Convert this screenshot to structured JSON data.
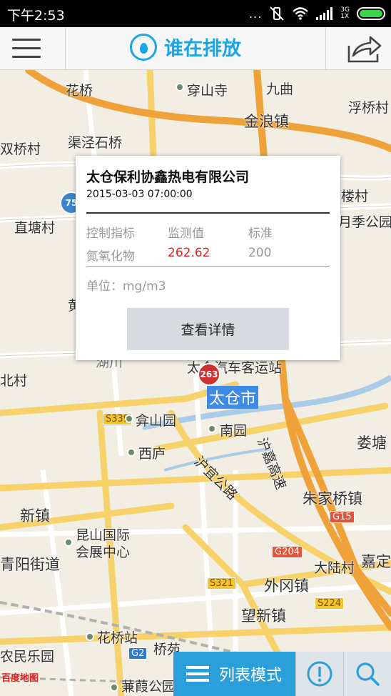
{
  "status_bar": {
    "time": "下午2:53",
    "dots": "...",
    "net_top": "3G",
    "net_bottom": "1X"
  },
  "header": {
    "title": "谁在排放"
  },
  "map": {
    "places": [
      {
        "name": "花桥"
      },
      {
        "name": "穿山寺"
      },
      {
        "name": "九曲"
      },
      {
        "name": "浮桥村"
      },
      {
        "name": "金浪镇"
      },
      {
        "name": "渠泾石桥"
      },
      {
        "name": "双桥村"
      },
      {
        "name": "楼村"
      },
      {
        "name": "月季公园"
      },
      {
        "name": "直塘村"
      },
      {
        "name": "黄"
      },
      {
        "name": "北村"
      },
      {
        "name": "湖川"
      },
      {
        "name": "太仓汽车客运站"
      },
      {
        "name": "弇山园"
      },
      {
        "name": "南园"
      },
      {
        "name": "娄塘"
      },
      {
        "name": "西庐"
      },
      {
        "name": "朱家桥镇"
      },
      {
        "name": "新镇"
      },
      {
        "name": "昆山国际"
      },
      {
        "name": "会展中心"
      },
      {
        "name": "青阳街道"
      },
      {
        "name": "大陆村"
      },
      {
        "name": "嘉定"
      },
      {
        "name": "外冈镇"
      },
      {
        "name": "望新镇"
      },
      {
        "name": "花桥站"
      },
      {
        "name": "桥苑"
      },
      {
        "name": "农民乐园"
      },
      {
        "name": "蒹葭公园"
      }
    ],
    "city": "太仓市",
    "road_labels": [
      "沪嘉高速",
      "沪宜公路"
    ],
    "shields": [
      "S339",
      "G15",
      "G204",
      "S321",
      "S224",
      "G2"
    ],
    "markers": [
      {
        "label": "75"
      },
      {
        "label": "263"
      }
    ],
    "attribution": "百度地图"
  },
  "popup": {
    "company": "太仓保利协鑫热电有限公司",
    "timestamp": "2015-03-03 07:00:00",
    "headers": [
      "控制指标",
      "监测值",
      "标准"
    ],
    "row": {
      "indicator": "氮氧化物",
      "value": "262.62",
      "standard": "200"
    },
    "unit": "单位：mg/m3",
    "details_button": "查看详情"
  },
  "bottom_bar": {
    "list_mode": "列表模式"
  },
  "colors": {
    "accent": "#1aa6e4",
    "value_red": "#e02020",
    "bar_blue": "#2a9fd9"
  }
}
